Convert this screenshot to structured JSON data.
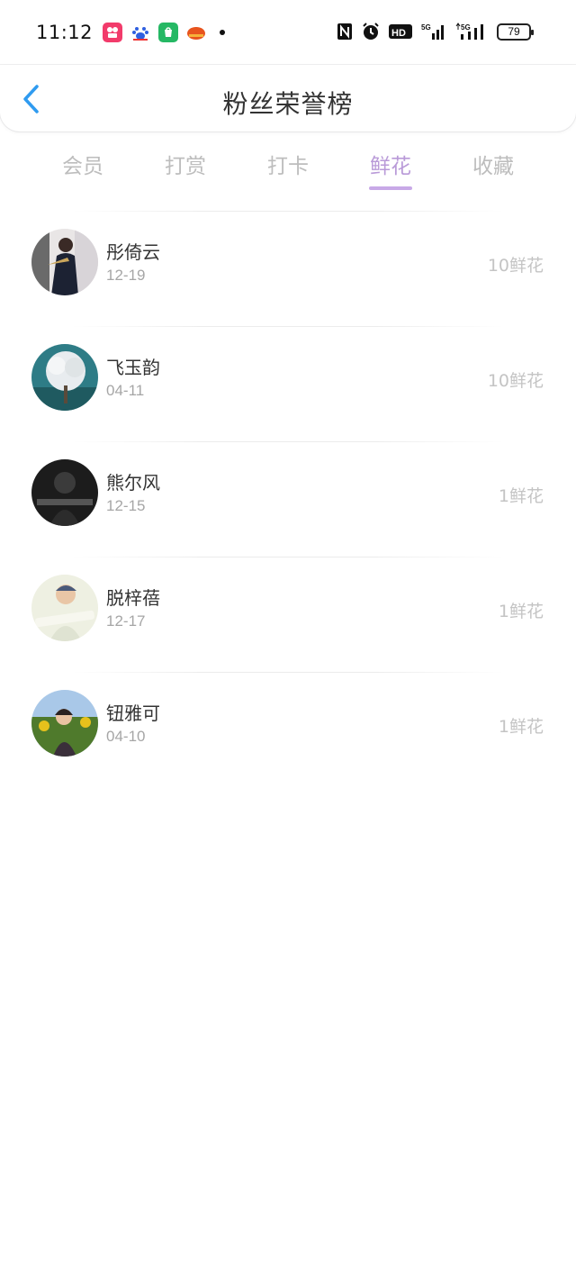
{
  "status_bar": {
    "time": "11:12",
    "battery": "79",
    "network_1": "5G",
    "network_2": "5G",
    "hd": "HD"
  },
  "header": {
    "title": "粉丝荣誉榜"
  },
  "tabs": [
    {
      "label": "会员",
      "active": false
    },
    {
      "label": "打赏",
      "active": false
    },
    {
      "label": "打卡",
      "active": false
    },
    {
      "label": "鲜花",
      "active": true
    },
    {
      "label": "收藏",
      "active": false
    }
  ],
  "fans": [
    {
      "name": "彤倚云",
      "date": "12-19",
      "amount": "10鲜花"
    },
    {
      "name": "飞玉韵",
      "date": "04-11",
      "amount": "10鲜花"
    },
    {
      "name": "熊尔风",
      "date": "12-15",
      "amount": "1鲜花"
    },
    {
      "name": "脱梓蓓",
      "date": "12-17",
      "amount": "1鲜花"
    },
    {
      "name": "钮雅可",
      "date": "04-10",
      "amount": "1鲜花"
    }
  ],
  "colors": {
    "accent": "#b99ad8",
    "back_arrow": "#2f9bf0",
    "muted_text": "#bdbdbd"
  }
}
